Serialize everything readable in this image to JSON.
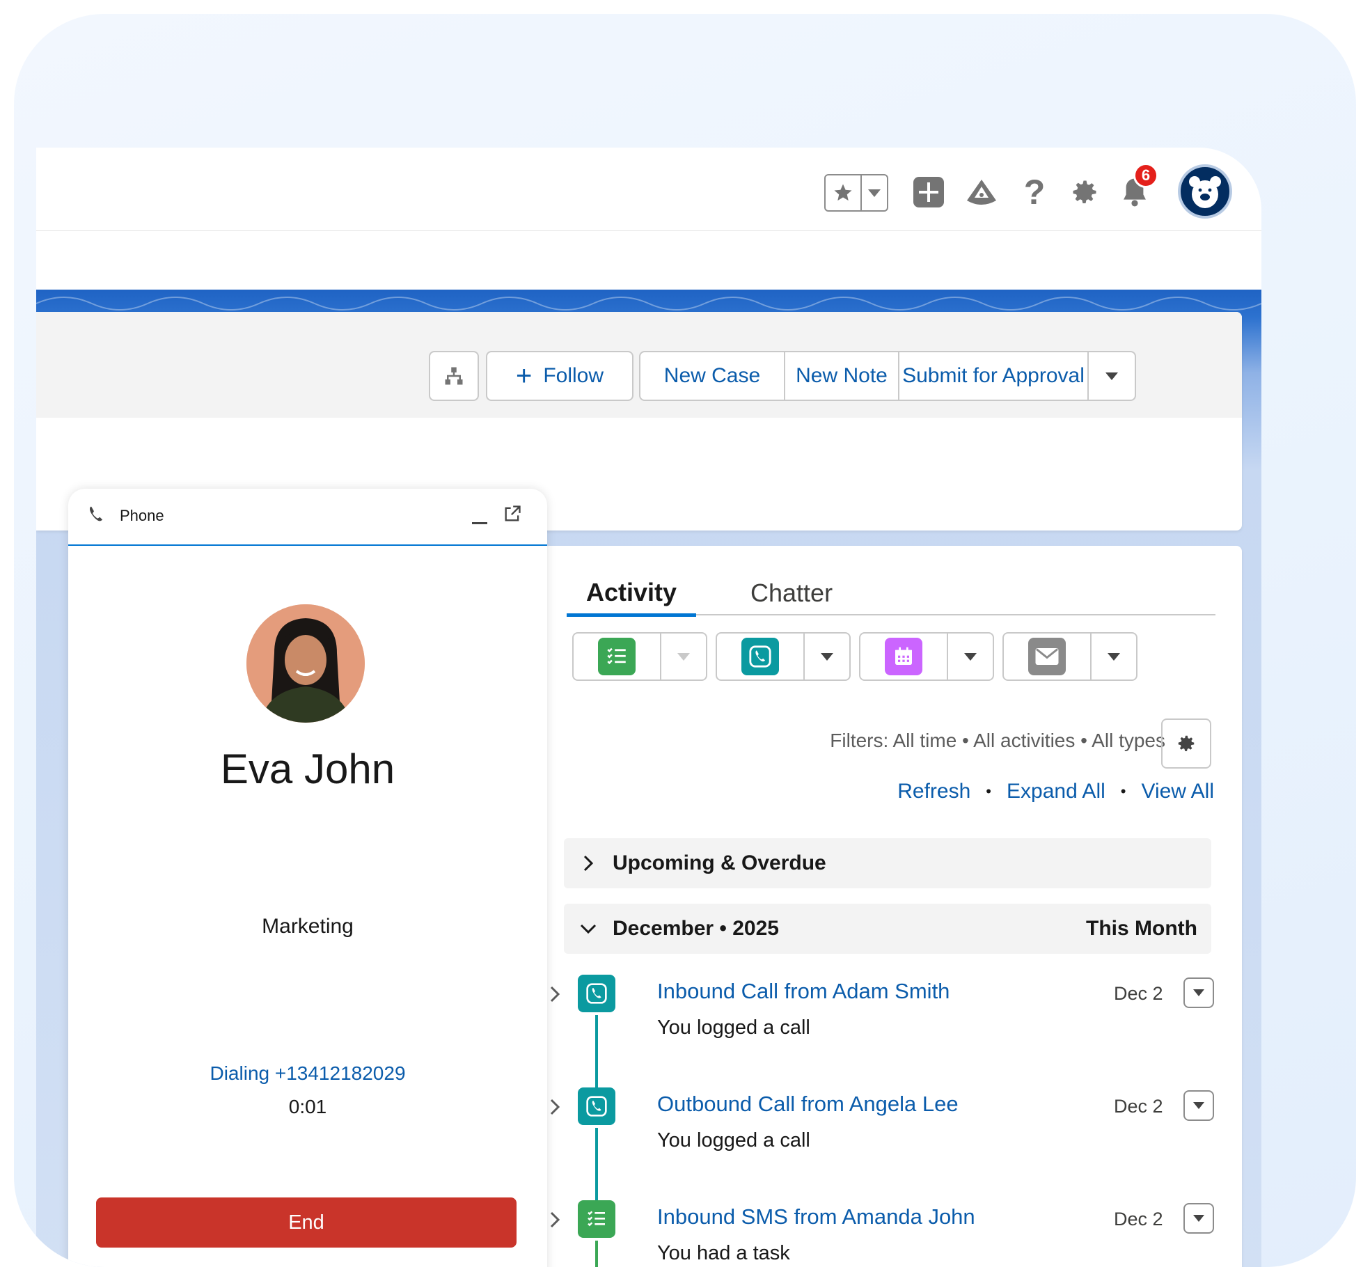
{
  "header": {
    "notifications_count": "6",
    "icons": [
      "star-icon",
      "chevron-down-icon",
      "add-icon",
      "trailhead-icon",
      "help-icon",
      "setup-gear-icon",
      "bell-icon",
      "avatar"
    ]
  },
  "record_actions": {
    "follow": "Follow",
    "new_case": "New Case",
    "new_note": "New Note",
    "submit_for_approval": "Submit for Approval"
  },
  "phone": {
    "title": "Phone",
    "contact_name": "Eva John",
    "department": "Marketing",
    "dialing": "Dialing +13412182029",
    "timer": "0:01",
    "end_label": "End"
  },
  "activity": {
    "tabs": [
      {
        "label": "Activity",
        "active": true
      },
      {
        "label": "Chatter",
        "active": false
      }
    ],
    "publishers": [
      "task-icon",
      "call-icon",
      "event-icon",
      "email-icon"
    ],
    "filters": "Filters: All time • All activities • All types",
    "links": {
      "refresh": "Refresh",
      "expand_all": "Expand All",
      "view_all": "View All"
    },
    "upcoming_label": "Upcoming & Overdue",
    "month_label": "December • 2025",
    "month_right": "This Month",
    "items": [
      {
        "type": "call",
        "title": "Inbound Call from Adam Smith",
        "subtitle": "You logged a call",
        "date": "Dec 2"
      },
      {
        "type": "call",
        "title": "Outbound Call from Angela Lee",
        "subtitle": "You logged a call",
        "date": "Dec 2"
      },
      {
        "type": "task",
        "title": "Inbound SMS from Amanda John",
        "subtitle": "You had a task",
        "date": "Dec 2"
      }
    ]
  },
  "colors": {
    "brand_blue": "#0176d3",
    "link_blue": "#0b5cab",
    "call_teal": "#0b9aa0",
    "task_green": "#3ba755",
    "event_purple": "#cb65ff",
    "email_gray": "#8a8a8a",
    "end_red": "#c9342a",
    "badge_red": "#e4201b"
  }
}
